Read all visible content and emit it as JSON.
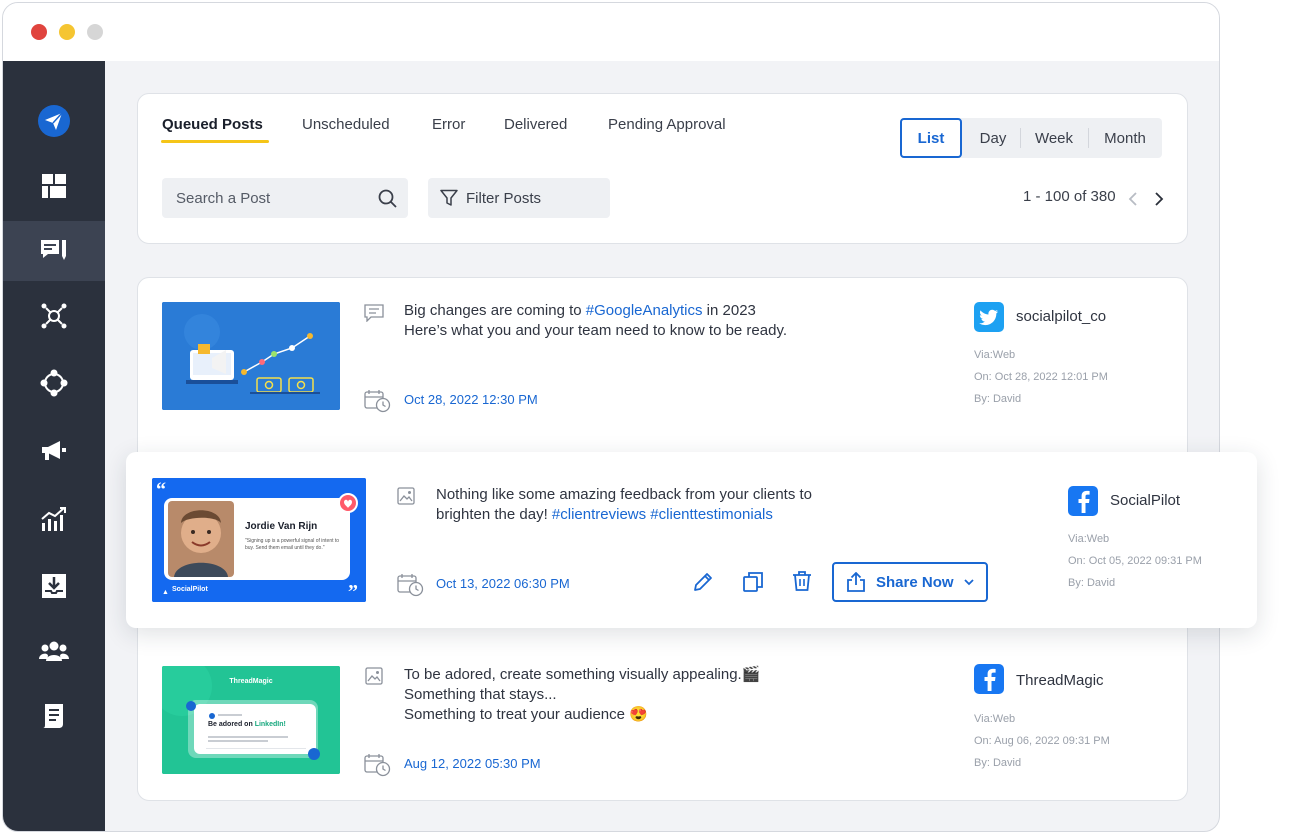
{
  "tabs": {
    "queued": "Queued Posts",
    "unscheduled": "Unscheduled",
    "error": "Error",
    "delivered": "Delivered",
    "pending": "Pending Approval"
  },
  "views": {
    "list": "List",
    "day": "Day",
    "week": "Week",
    "month": "Month"
  },
  "search": {
    "placeholder": "Search a Post"
  },
  "filter": {
    "label": "Filter Posts"
  },
  "pagination": {
    "range": "1 - 100 of 380"
  },
  "posts": [
    {
      "text_line1_pre": "Big changes are coming to ",
      "text_line1_tag": "#GoogleAnalytics",
      "text_line1_post": " in 2023",
      "text_line2": "Here’s what you and your team need to know to be ready.",
      "date": "Oct 28, 2022 12:30 PM",
      "account": "socialpilot_co",
      "network": "twitter",
      "via": "Via:Web",
      "on": "On: Oct 28, 2022 12:01 PM",
      "by": "By: David"
    },
    {
      "text_line1": "Nothing like some amazing feedback from your clients to",
      "text_line2_pre": "brighten the day!  ",
      "text_line2_tag1": "#clientreviews",
      "text_line2_tag2": " #clienttestimonials",
      "date": "Oct 13, 2022 06:30 PM",
      "account": "SocialPilot",
      "network": "facebook",
      "via": "Via:Web",
      "on": "On: Oct 05, 2022 09:31 PM",
      "by": "By: David",
      "share_label": "Share Now",
      "thumb_name": "Jordie Van Rijn",
      "thumb_quote": "\"Signing up is a powerful signal of intent to buy. Send them email until they do.\"",
      "thumb_brand": "SocialPilot"
    },
    {
      "text_line1": "To be adored, create something visually appealing.🎬",
      "text_line2": "Something that stays...",
      "text_line3": "Something to treat your audience 😍",
      "date": "Aug 12, 2022 05:30 PM",
      "account": "ThreadMagic",
      "network": "facebook",
      "via": "Via:Web",
      "on": "On: Aug 06, 2022 09:31 PM",
      "by": "By: David",
      "thumb_brand": "ThreadMagic",
      "thumb_title_pre": "Be adored on ",
      "thumb_title_tag": "LinkedIn!"
    }
  ],
  "colors": {
    "accent": "#1967d2",
    "tab_underline": "#f5c518",
    "sidebar": "#2b313d",
    "twitter": "#1da1f2",
    "facebook": "#1877f2"
  }
}
